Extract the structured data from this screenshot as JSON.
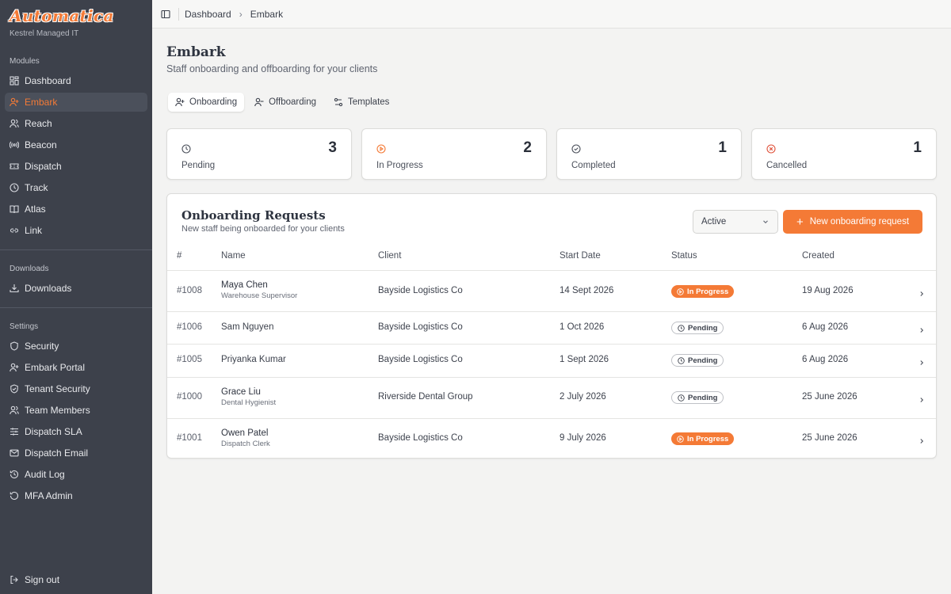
{
  "brand": {
    "logo_text": "Automatica",
    "org_name": "Kestrel Managed IT",
    "accent": "#f47a36"
  },
  "sidebar": {
    "modules_label": "Modules",
    "modules": [
      {
        "label": "Dashboard",
        "icon": "grid-icon"
      },
      {
        "label": "Embark",
        "icon": "user-plus-icon",
        "active": true
      },
      {
        "label": "Reach",
        "icon": "users-icon"
      },
      {
        "label": "Beacon",
        "icon": "broadcast-icon"
      },
      {
        "label": "Dispatch",
        "icon": "ticket-icon"
      },
      {
        "label": "Track",
        "icon": "clock-icon"
      },
      {
        "label": "Atlas",
        "icon": "book-icon"
      },
      {
        "label": "Link",
        "icon": "link-icon"
      }
    ],
    "downloads_label": "Downloads",
    "downloads": [
      {
        "label": "Downloads",
        "icon": "download-icon"
      }
    ],
    "settings_label": "Settings",
    "settings": [
      {
        "label": "Security",
        "icon": "shield-icon"
      },
      {
        "label": "Embark Portal",
        "icon": "user-plus-icon"
      },
      {
        "label": "Tenant Security",
        "icon": "shield-check-icon"
      },
      {
        "label": "Team Members",
        "icon": "users-icon"
      },
      {
        "label": "Dispatch SLA",
        "icon": "sliders-icon"
      },
      {
        "label": "Dispatch Email",
        "icon": "mail-icon"
      },
      {
        "label": "Audit Log",
        "icon": "history-icon"
      },
      {
        "label": "MFA Admin",
        "icon": "history-icon"
      }
    ],
    "sign_out": "Sign out"
  },
  "topbar": {
    "breadcrumb": [
      "Dashboard",
      "Embark"
    ]
  },
  "page": {
    "title": "Embark",
    "subtitle": "Staff onboarding and offboarding for your clients"
  },
  "tabs": [
    {
      "label": "Onboarding",
      "active": true
    },
    {
      "label": "Offboarding"
    },
    {
      "label": "Templates"
    }
  ],
  "stats": [
    {
      "label": "Pending",
      "value": "3",
      "icon": "clock-icon"
    },
    {
      "label": "In Progress",
      "value": "2",
      "icon": "play-circle-icon"
    },
    {
      "label": "Completed",
      "value": "1",
      "icon": "check-circle-icon"
    },
    {
      "label": "Cancelled",
      "value": "1",
      "icon": "x-circle-icon"
    }
  ],
  "requests": {
    "title": "Onboarding Requests",
    "subtitle": "New staff being onboarded for your clients",
    "filter_value": "Active",
    "new_button": "New onboarding request",
    "columns": [
      "#",
      "Name",
      "Client",
      "Start Date",
      "Status",
      "Created"
    ],
    "rows": [
      {
        "id": "#1008",
        "name": "Maya Chen",
        "role": "Warehouse Supervisor",
        "client": "Bayside Logistics Co",
        "start": "14 Sept 2026",
        "status": "In Progress",
        "created": "19 Aug 2026"
      },
      {
        "id": "#1006",
        "name": "Sam Nguyen",
        "role": "",
        "client": "Bayside Logistics Co",
        "start": "1 Oct 2026",
        "status": "Pending",
        "created": "6 Aug 2026"
      },
      {
        "id": "#1005",
        "name": "Priyanka Kumar",
        "role": "",
        "client": "Bayside Logistics Co",
        "start": "1 Sept 2026",
        "status": "Pending",
        "created": "6 Aug 2026"
      },
      {
        "id": "#1000",
        "name": "Grace Liu",
        "role": "Dental Hygienist",
        "client": "Riverside Dental Group",
        "start": "2 July 2026",
        "status": "Pending",
        "created": "25 June 2026"
      },
      {
        "id": "#1001",
        "name": "Owen Patel",
        "role": "Dispatch Clerk",
        "client": "Bayside Logistics Co",
        "start": "9 July 2026",
        "status": "In Progress",
        "created": "25 June 2026"
      }
    ]
  }
}
